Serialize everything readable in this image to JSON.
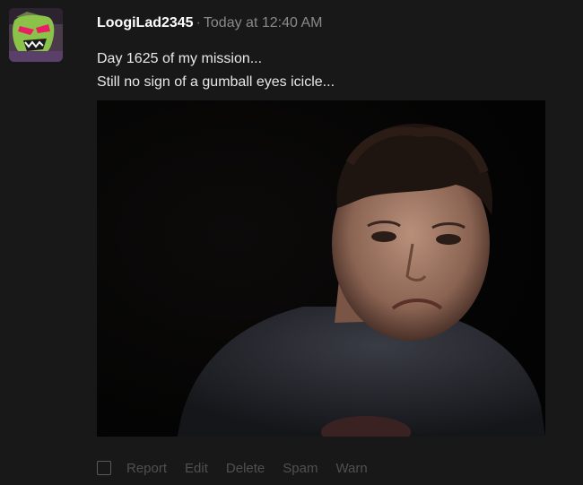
{
  "post": {
    "username": "LoogiLad2345",
    "separator": "·",
    "timestamp": "Today at 12:40 AM",
    "message_lines": [
      "Day 1625 of my mission...",
      "Still no sign of a gumball eyes icicle..."
    ],
    "avatar_icon": "alien-character-avatar",
    "attachment_icon": "photo-attachment"
  },
  "actions": {
    "checkbox_checked": false,
    "report": "Report",
    "edit": "Edit",
    "delete": "Delete",
    "spam": "Spam",
    "warn": "Warn"
  },
  "colors": {
    "background": "#191819",
    "username": "#ffffff",
    "timestamp": "#8a8a8a",
    "message": "#e8e8e8",
    "actions": "#505050"
  }
}
